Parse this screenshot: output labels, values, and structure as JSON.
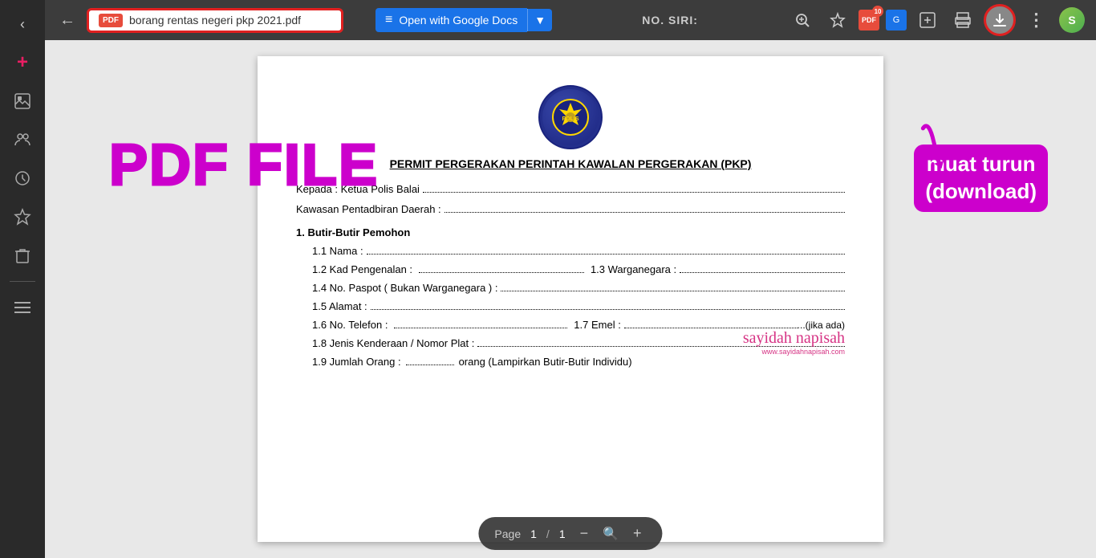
{
  "sidebar": {
    "items": [
      {
        "name": "back-arrow",
        "icon": "‹",
        "label": "Back"
      },
      {
        "name": "plus-icon",
        "icon": "+",
        "label": "Add"
      },
      {
        "name": "images-icon",
        "icon": "🖼",
        "label": "Images"
      },
      {
        "name": "people-icon",
        "icon": "👥",
        "label": "People"
      },
      {
        "name": "recent-icon",
        "icon": "🕐",
        "label": "Recent"
      },
      {
        "name": "star-icon",
        "icon": "☆",
        "label": "Starred"
      },
      {
        "name": "trash-icon",
        "icon": "🗑",
        "label": "Trash"
      },
      {
        "name": "menu-icon",
        "icon": "☰",
        "label": "Menu"
      }
    ]
  },
  "topbar": {
    "back_label": "←",
    "file_name": "borang rentas negeri pkp 2021.pdf",
    "pdf_icon_label": "PDF",
    "open_docs_label": "Open with Google Docs",
    "dropdown_arrow": "▼",
    "no_siri_label": "NO. SIRI:",
    "add_icon": "⊕",
    "print_icon": "🖨",
    "download_icon": "⬇",
    "more_icon": "⋮",
    "ext_badge": "10"
  },
  "annotations": {
    "pdf_file_label": "PDF FILE",
    "muat_turun_line1": "muat turun",
    "muat_turun_line2": "(download)"
  },
  "pdf": {
    "title": "PERMIT PERGERAKAN PERINTAH KAWALAN PERGERAKAN (PKP)",
    "field1_label": "Kepada : Ketua Polis Balai",
    "field2_label": "Kawasan Pentadbiran Daerah :",
    "section1_label": "1.   Butir-Butir Pemohon",
    "field_1_1": "1.1 Nama :",
    "field_1_2_a": "1.2 Kad Pengenalan :",
    "field_1_2_b": "1.3  Warganegara :",
    "field_1_4": "1.4 No. Paspot ( Bukan Warganegara ) :",
    "field_1_5": "1.5 Alamat :",
    "field_1_6_a": "1.6 No. Telefon :",
    "field_1_6_b": "1.7  Emel :",
    "field_1_6_c": "...(jika ada)",
    "field_1_8": "1.8 Jenis Kenderaan / N",
    "field_1_8_cont": "omor Plat :",
    "field_1_9": "1.9 Jumlah Orang :",
    "field_1_9_cont": "orang (Lampirkan Butir-Butir Individu)",
    "signature_name": "sayidah napisah",
    "signature_website": "www.sayidahnapisah.com"
  },
  "page_controls": {
    "label": "Page",
    "current": "1",
    "separator": "/",
    "total": "1",
    "zoom_icon": "🔍"
  }
}
